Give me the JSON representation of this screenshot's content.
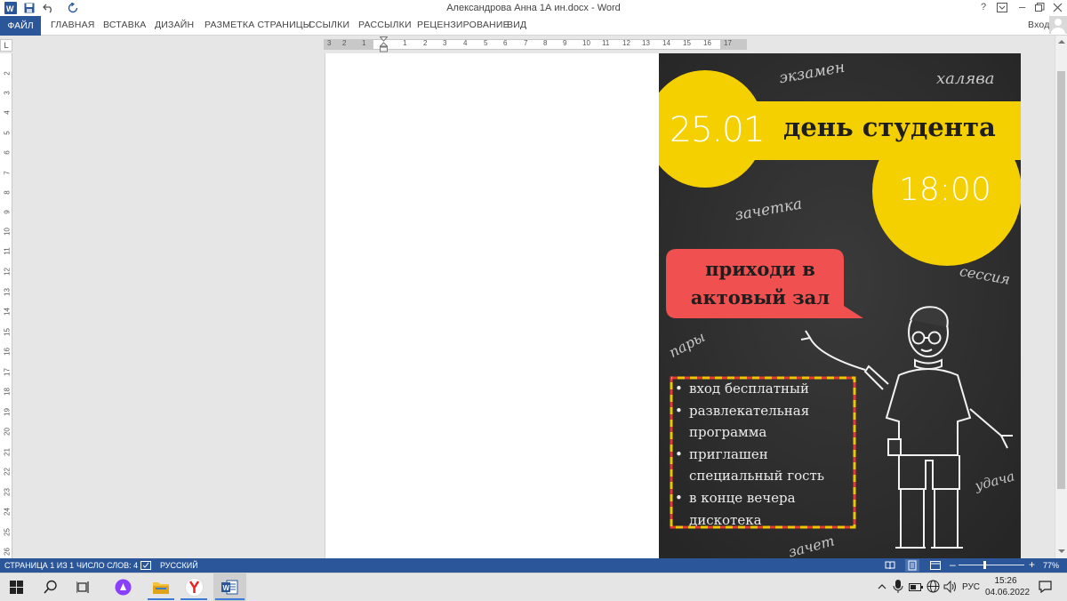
{
  "window": {
    "title": "Александрова Анна 1А ин.docx - Word",
    "help": "?",
    "minimize": "–"
  },
  "ribbon": {
    "file_tab": "ФАЙЛ",
    "tabs": [
      "ГЛАВНАЯ",
      "ВСТАВКА",
      "ДИЗАЙН",
      "РАЗМЕТКА СТРАНИЦЫ",
      "ССЫЛКИ",
      "РАССЫЛКИ",
      "РЕЦЕНЗИРОВАНИЕ",
      "ВИД"
    ],
    "signin": "Вход"
  },
  "ruler": {
    "corner": "L",
    "h_numbers": [
      "3",
      "2",
      "1",
      "1",
      "2",
      "3",
      "4",
      "5",
      "6",
      "7",
      "8",
      "9",
      "10",
      "11",
      "12",
      "13",
      "14",
      "15",
      "16",
      "17"
    ],
    "v_numbers": [
      "2",
      "3",
      "4",
      "5",
      "6",
      "7",
      "8",
      "9",
      "10",
      "11",
      "12",
      "13",
      "14",
      "15",
      "16",
      "17",
      "18",
      "19",
      "20",
      "21",
      "22",
      "23",
      "24",
      "25",
      "26"
    ]
  },
  "poster": {
    "date": "25.01",
    "headline": "день студента",
    "time": "18:00",
    "bubble": [
      "приходи в",
      "актовый зал"
    ],
    "scribbles": [
      "экзамен",
      "халява",
      "зачетка",
      "сессия",
      "пары",
      "удача",
      "зачет"
    ],
    "bullets": [
      [
        "вход бесплатный"
      ],
      [
        "развлекательная",
        "программа"
      ],
      [
        "приглашен",
        "специальный гость"
      ],
      [
        "в конце вечера",
        "дискотека"
      ]
    ],
    "colors": {
      "board": "#323232",
      "accent_yellow": "#f5d000",
      "bubble_red": "#f05050",
      "frame_dash_red": "#e53935"
    }
  },
  "status": {
    "page": "СТРАНИЦА 1 ИЗ 1",
    "words": "ЧИСЛО СЛОВ: 4",
    "language": "РУССКИЙ",
    "zoom": "77%",
    "zoom_minus": "–",
    "zoom_plus": "+"
  },
  "taskbar": {
    "lang": "РУС",
    "time": "15:26",
    "date": "04.06.2022",
    "icons": [
      "windows-start-icon",
      "search-icon",
      "task-view-icon",
      "alice-icon",
      "file-explorer-icon",
      "yandex-browser-icon",
      "word-icon"
    ]
  }
}
